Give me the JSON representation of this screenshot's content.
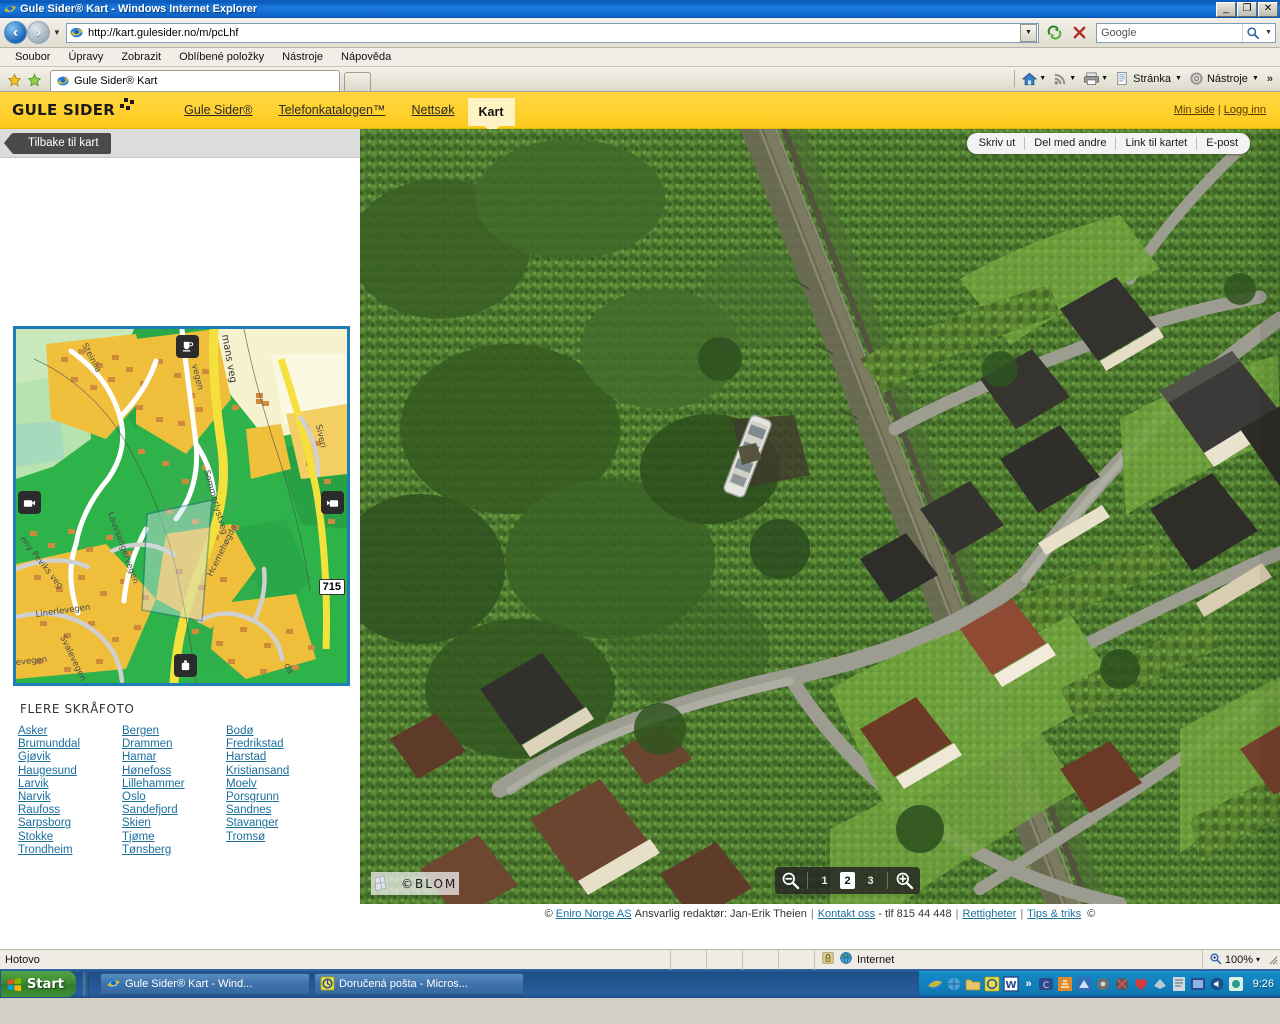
{
  "window": {
    "title": "Gule Sider® Kart - Windows Internet Explorer",
    "minimize": "_",
    "maximize": "❐",
    "close": "✕"
  },
  "browser": {
    "url": "http://kart.gulesider.no/m/pcLhf",
    "search_placeholder": "Google",
    "menu": [
      "Soubor",
      "Úpravy",
      "Zobrazit",
      "Oblíbené položky",
      "Nástroje",
      "Nápověda"
    ],
    "tab_title": "Gule Sider® Kart",
    "toolbar_right": {
      "page_label": "Stránka",
      "tools_label": "Nástroje",
      "overflow": "»"
    }
  },
  "site_header": {
    "logo": "GULE SIDER",
    "nav": [
      {
        "label": "Gule Sider®",
        "active": false
      },
      {
        "label": "Telefonkatalogen™",
        "active": false
      },
      {
        "label": "Nettsøk",
        "active": false
      },
      {
        "label": "Kart",
        "active": true
      }
    ],
    "account": {
      "min_side": "Min side",
      "separator": "|",
      "logg_inn": "Logg inn"
    }
  },
  "map_toolbar": {
    "back_label": "Tilbake til kart"
  },
  "share_bar": {
    "items": [
      "Skriv ut",
      "Del med andre",
      "Link til kartet",
      "E-post"
    ]
  },
  "minimap": {
    "road_number": "715",
    "labels": [
      "Steinlia",
      "mans veg",
      "vegen",
      "Sommerlystveg",
      "Siveri",
      "nny Peviks veg",
      "Lauvsangervegen",
      "Linerlevegen",
      "Svalevegen",
      "evegen",
      "Hcemehøgda",
      "da"
    ]
  },
  "skrafoto": {
    "title": "FLERE SKRÅFOTO",
    "columns": [
      [
        "Asker",
        "Brumunddal",
        "Gjøvik",
        "Haugesund",
        "Larvik",
        "Narvik",
        "Raufoss",
        "Sarpsborg",
        "Stokke",
        "Trondheim"
      ],
      [
        "Bergen",
        "Drammen",
        "Hamar",
        "Hønefoss",
        "Lillehammer",
        "Oslo",
        "Sandefjord",
        "Skien",
        "Tjøme",
        "Tønsberg"
      ],
      [
        "Bodø",
        "Fredrikstad",
        "Harstad",
        "Kristiansand",
        "Moelv",
        "Porsgrunn",
        "Sandnes",
        "Stavanger",
        "Tromsø"
      ]
    ]
  },
  "photo": {
    "watermark": "©BLOM",
    "zoom_levels": [
      "1",
      "2",
      "3"
    ],
    "zoom_selected": "2",
    "zoom_out_icon": "zoom-out-icon",
    "zoom_in_icon": "zoom-in-icon"
  },
  "page_footer": {
    "copyright_mark": "©",
    "company": "Eniro Norge AS",
    "editor": "Ansvarlig redaktør: Jan-Erik Theien",
    "contact": "Kontakt oss",
    "phone": "- tlf 815 44 448",
    "rights": "Rettigheter",
    "tips": "Tips & triks",
    "trailing_mark": "©"
  },
  "status_bar": {
    "message": "Hotovo",
    "zone": "Internet",
    "zoom": "100%",
    "zoom_caret": "▾"
  },
  "taskbar": {
    "start": "Start",
    "items": [
      {
        "label": "Gule Sider® Kart - Wind...",
        "icon": "internet-explorer-icon"
      },
      {
        "label": "Doručená pošta - Micros...",
        "icon": "outlook-icon"
      }
    ],
    "quicklaunch_overflow": "»",
    "clock": "9:26"
  },
  "colors": {
    "brand_yellow": "#ffd12e",
    "link_blue": "#1b6f9c",
    "minimap_border": "#1e7eb4",
    "ie_blue": "#1a7ae0"
  }
}
